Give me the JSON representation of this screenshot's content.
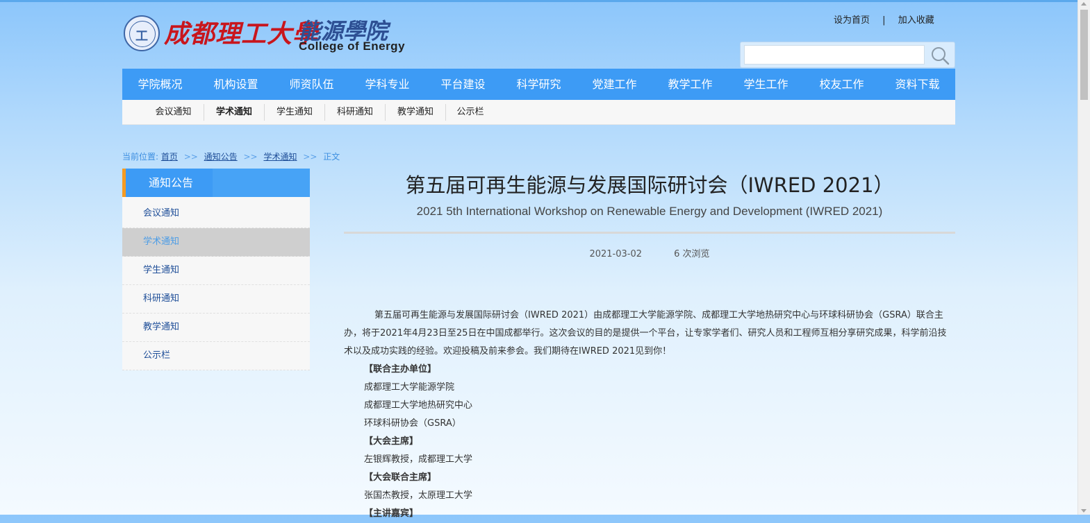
{
  "header": {
    "seal_mark": "工",
    "university_name": "成都理工大學",
    "college_name_cn": "能源學院",
    "college_name_en": "College of Energy",
    "links": [
      "设为首页",
      "加入收藏"
    ],
    "link_separator": "|",
    "search_placeholder": ""
  },
  "main_nav": [
    "学院概况",
    "机构设置",
    "师资队伍",
    "学科专业",
    "平台建设",
    "科学研究",
    "党建工作",
    "教学工作",
    "学生工作",
    "校友工作",
    "资料下载"
  ],
  "sub_nav": {
    "items": [
      "会议通知",
      "学术通知",
      "学生通知",
      "科研通知",
      "教学通知",
      "公示栏"
    ],
    "active_index": 1
  },
  "breadcrumb": {
    "prefix": "当前位置:",
    "items": [
      "首页",
      "通知公告",
      "学术通知"
    ],
    "separator": ">>",
    "current": "正文"
  },
  "sidebar": {
    "title": "通知公告",
    "items": [
      "会议通知",
      "学术通知",
      "学生通知",
      "科研通知",
      "教学通知",
      "公示栏"
    ],
    "active_index": 1
  },
  "article": {
    "title": "第五届可再生能源与发展国际研讨会（IWRED 2021）",
    "subtitle": "2021 5th International Workshop on Renewable Energy and Development (IWRED 2021)",
    "date": "2021-03-02",
    "views": "6 次浏览",
    "intro": "第五届可再生能源与发展国际研讨会（IWRED 2021）由成都理工大学能源学院、成都理工大学地热研究中心与环球科研协会（GSRA）联合主办，将于2021年4月23日至25日在中国成都举行。这次会议的目的是提供一个平台，让专家学者们、研究人员和工程师互相分享研究成果，科学前沿技术以及成功实践的经验。欢迎投稿及前来参会。我们期待在IWRED 2021见到你！",
    "organizers_heading": "【联合主办单位】",
    "organizers": [
      "成都理工大学能源学院",
      "成都理工大学地热研究中心",
      "环球科研协会（GSRA）"
    ],
    "chair_heading": "【大会主席】",
    "chair": "左银辉教授，成都理工大学",
    "cochair_heading": "【大会联合主席】",
    "cochair": "张国杰教授，太原理工大学",
    "speakers_heading": "【主讲嘉宾】"
  },
  "colors": {
    "nav_blue": "#3d9bf5",
    "accent_orange": "#f59b22",
    "link_blue": "#1e4e98",
    "brand_red": "#c8161d"
  }
}
